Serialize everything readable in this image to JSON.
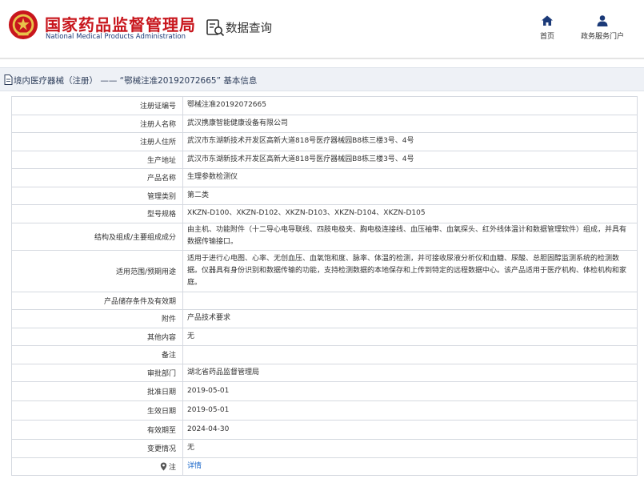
{
  "header": {
    "brand_cn": "国家药品监督管理局",
    "brand_en": "National Medical Products Administration",
    "section": "数据查询",
    "nav": [
      {
        "label": "首页",
        "icon": "home-icon"
      },
      {
        "label": "政务服务门户",
        "icon": "user-icon"
      }
    ]
  },
  "breadcrumb": {
    "text": "境内医疗器械（注册） —— “鄂械注准20192072665” 基本信息",
    "icon": "document-icon"
  },
  "colors": {
    "brand_red": "#c8161d",
    "brand_blue": "#1b3a78",
    "link_blue": "#1a66c9",
    "crumb_bg": "#eef1f6"
  },
  "record": {
    "rows": [
      {
        "key": "注册证编号",
        "value": "鄂械注准20192072665"
      },
      {
        "key": "注册人名称",
        "value": "武汉携康智能健康设备有限公司"
      },
      {
        "key": "注册人住所",
        "value": "武汉市东湖新技术开发区高新大道818号医疗器械园B8栋三楼3号、4号"
      },
      {
        "key": "生产地址",
        "value": "武汉市东湖新技术开发区高新大道818号医疗器械园B8栋三楼3号、4号"
      },
      {
        "key": "产品名称",
        "value": "生理参数检测仪"
      },
      {
        "key": "管理类别",
        "value": "第二类"
      },
      {
        "key": "型号规格",
        "value": "XKZN-D100、XKZN-D102、XKZN-D103、XKZN-D104、XKZN-D105"
      },
      {
        "key": "结构及组成/主要组成成分",
        "value": "由主机、功能附件（十二导心电导联线、四肢电极夹、胸电极连接线、血压袖带、血氧探头、红外线体温计和数据管理软件）组成，并具有数据传输接口。"
      },
      {
        "key": "适用范围/预期用途",
        "value": "适用于进行心电图、心率、无创血压、血氧饱和度、脉率、体温的检测，并可接收尿液分析仪和血糖、尿酸、总胆固醇监测系统的检测数据。仪器具有身份识别和数据传输的功能，支持检测数据的本地保存和上传到特定的远程数据中心。该产品适用于医疗机构、体检机构和家庭。"
      },
      {
        "key": "产品储存条件及有效期",
        "value": ""
      },
      {
        "key": "附件",
        "value": "产品技术要求"
      },
      {
        "key": "其他内容",
        "value": "无"
      },
      {
        "key": "备注",
        "value": ""
      },
      {
        "key": "审批部门",
        "value": "湖北省药品监督管理局"
      },
      {
        "key": "批准日期",
        "value": "2019-05-01"
      },
      {
        "key": "生效日期",
        "value": "2019-05-01"
      },
      {
        "key": "有效期至",
        "value": "2024-04-30"
      },
      {
        "key": "变更情况",
        "value": "无"
      },
      {
        "key": "注",
        "value": "详情"
      }
    ]
  }
}
